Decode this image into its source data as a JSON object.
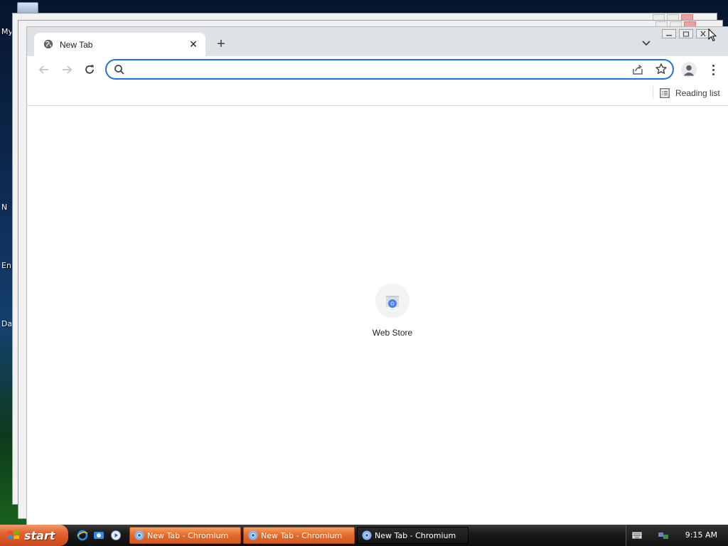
{
  "desktop": {
    "icon_labels": [
      "My",
      "N",
      "En",
      "Da"
    ]
  },
  "browser": {
    "tab": {
      "title": "New Tab",
      "favicon": "globe-icon",
      "close_glyph": "✕"
    },
    "new_tab_glyph": "+",
    "omnibox": {
      "value": "",
      "placeholder": ""
    },
    "bookmarks_bar": {
      "reading_list_label": "Reading list"
    },
    "shortcuts": [
      {
        "label": "Web Store",
        "icon": "web-store-icon"
      }
    ],
    "accent_color": "#1a73e8"
  },
  "taskbar": {
    "start_label": "start",
    "quick_launch": [
      "internet-explorer-icon",
      "outlook-express-icon",
      "media-player-icon"
    ],
    "tasks": [
      {
        "label": "New Tab - Chromium",
        "state": "inactive"
      },
      {
        "label": "New Tab - Chromium",
        "state": "inactive"
      },
      {
        "label": "New Tab - Chromium",
        "state": "active"
      }
    ],
    "clock": "9:15 AM"
  }
}
